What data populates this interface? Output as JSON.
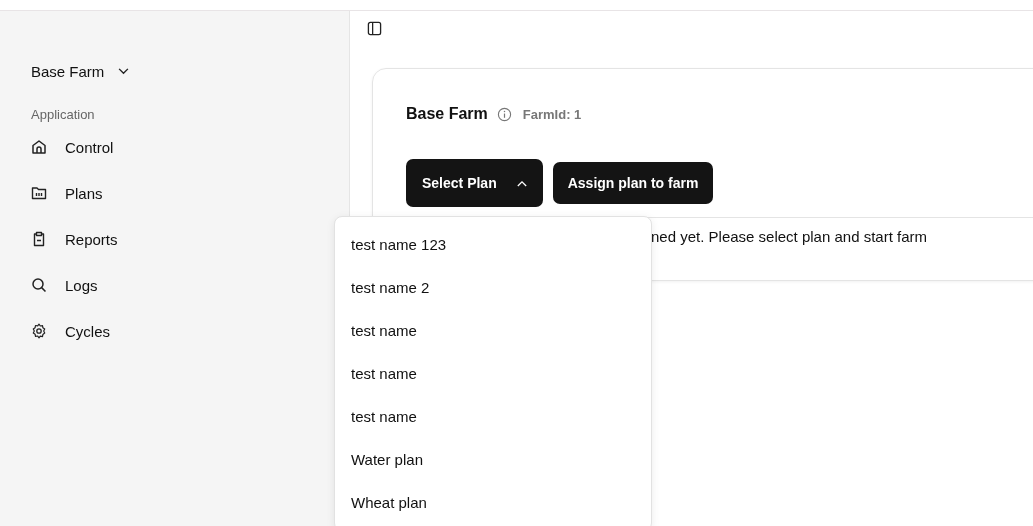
{
  "sidebar": {
    "farm_switcher": {
      "label": "Base Farm"
    },
    "section_label": "Application",
    "items": [
      {
        "label": "Control",
        "kind": "home"
      },
      {
        "label": "Plans",
        "kind": "folder"
      },
      {
        "label": "Reports",
        "kind": "clipboard"
      },
      {
        "label": "Logs",
        "kind": "search"
      },
      {
        "label": "Cycles",
        "kind": "gear"
      }
    ]
  },
  "farm_card": {
    "title": "Base Farm",
    "farm_id": "FarmId: 1",
    "select_plan": {
      "label": "Select Plan",
      "expanded": true
    },
    "assign_button": "Assign plan to farm",
    "message": "ned yet. Please select plan and start farm"
  },
  "plan_menu": {
    "options": [
      "test name 123",
      "test name 2",
      "test name",
      "test name",
      "test name",
      "Water plan",
      "Wheat plan"
    ]
  }
}
